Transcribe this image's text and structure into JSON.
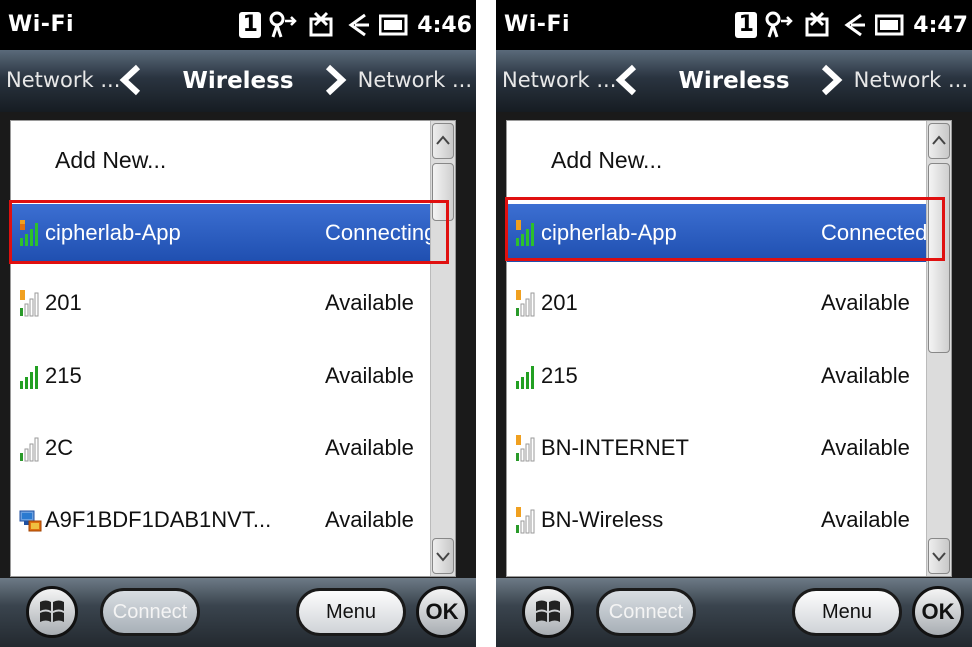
{
  "screens": [
    {
      "status": {
        "title": "Wi-Fi",
        "time": "4:46",
        "badge": "1"
      },
      "nav": {
        "prev": "Network ...",
        "title": "Wireless",
        "next": "Network ..."
      },
      "add_new": "Add New...",
      "networks": [
        {
          "name": "cipherlab-App",
          "status": "Connecting",
          "signal": "full-lock"
        },
        {
          "name": "201",
          "status": "Available",
          "signal": "low-lock"
        },
        {
          "name": "215",
          "status": "Available",
          "signal": "full"
        },
        {
          "name": "2C",
          "status": "Available",
          "signal": "low"
        },
        {
          "name": "A9F1BDF1DAB1NVT...",
          "status": "Available",
          "signal": "adhoc"
        }
      ],
      "buttons": {
        "connect": "Connect",
        "menu": "Menu",
        "ok": "OK"
      }
    },
    {
      "status": {
        "title": "Wi-Fi",
        "time": "4:47",
        "badge": "1"
      },
      "nav": {
        "prev": "Network ...",
        "title": "Wireless",
        "next": "Network ..."
      },
      "add_new": "Add New...",
      "networks": [
        {
          "name": "cipherlab-App",
          "status": "Connected",
          "signal": "full-lock"
        },
        {
          "name": "201",
          "status": "Available",
          "signal": "low-lock"
        },
        {
          "name": "215",
          "status": "Available",
          "signal": "full"
        },
        {
          "name": "BN-INTERNET",
          "status": "Available",
          "signal": "low-lock"
        },
        {
          "name": "BN-Wireless",
          "status": "Available",
          "signal": "low-lock"
        }
      ],
      "buttons": {
        "connect": "Connect",
        "menu": "Menu",
        "ok": "OK"
      }
    }
  ],
  "colors": {
    "selection": "#2a5bc0",
    "highlight_border": "#e01010",
    "signal_green": "#22a022"
  }
}
